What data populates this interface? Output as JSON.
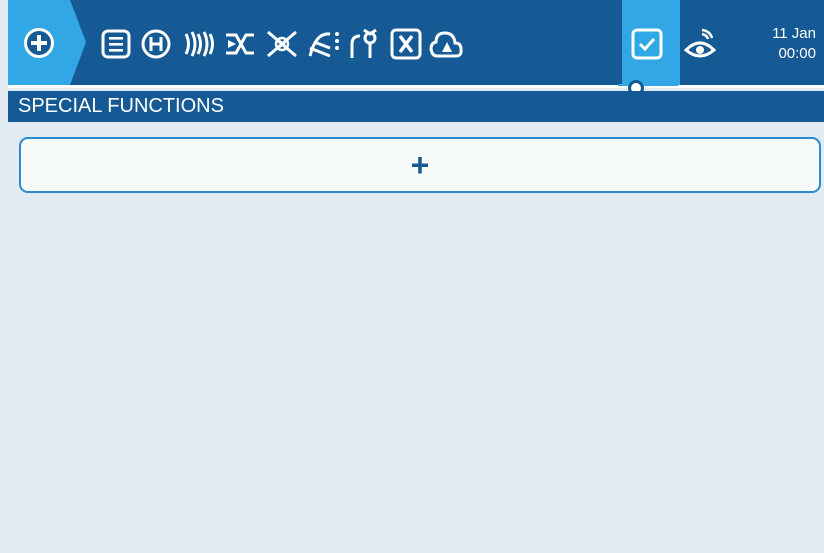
{
  "topbar": {
    "home_icon": "plus-circle-icon",
    "icons": [
      "model-list-icon",
      "heli-icon",
      "sound-waves-icon",
      "mixer-icon",
      "crossed-outputs-icon",
      "curves-icon",
      "logical-switch-icon",
      "variable-icon",
      "telemetry-cloud-icon",
      "special-functions-icon",
      "trainer-eye-icon"
    ],
    "active_icon": "special-functions-icon",
    "date": "11 Jan",
    "time": "00:00"
  },
  "section": {
    "title": "SPECIAL FUNCTIONS"
  },
  "add_button": {
    "label": "+"
  },
  "colors": {
    "bar": "#155a94",
    "accent": "#31a7e6",
    "background": "#e2ebf1",
    "button_border": "#2b8ad0"
  }
}
